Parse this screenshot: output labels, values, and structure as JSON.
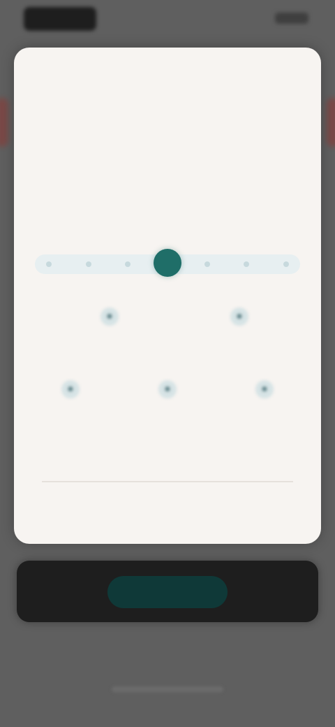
{
  "colors": {
    "background": "#5f5f5f",
    "card": "#f7f4f1",
    "accent": "#1f6e68",
    "track": "#e7eff1",
    "dark": "#1e1e1e",
    "button": "#0f3938",
    "accent2": "#8a3a36"
  },
  "status_bar": {
    "clock": "",
    "icons": [
      "signal-icon",
      "battery-icon"
    ]
  },
  "dialog": {
    "title": "",
    "description": "",
    "scale_label": "",
    "slider": {
      "steps": 7,
      "selected_index": 3
    },
    "options_row1": [
      {
        "icon": "circle-icon",
        "label": ""
      },
      {
        "icon": "circle-icon",
        "label": ""
      }
    ],
    "options_row2": [
      {
        "icon": "circle-icon",
        "label": ""
      },
      {
        "icon": "circle-icon",
        "label": ""
      },
      {
        "icon": "circle-icon",
        "label": ""
      }
    ],
    "footer_link": ""
  },
  "action_bar": {
    "primary_label": ""
  }
}
